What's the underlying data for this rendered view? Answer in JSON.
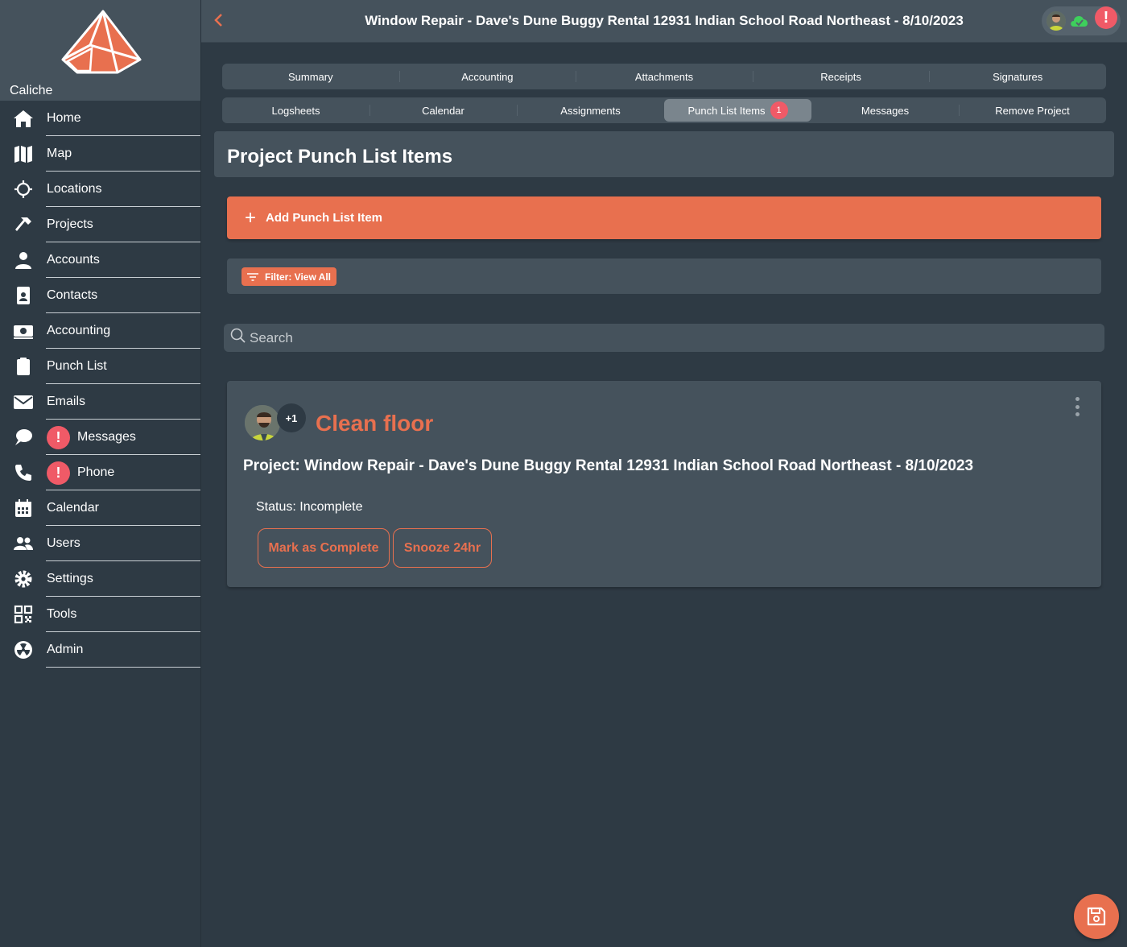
{
  "brand": {
    "name": "Caliche"
  },
  "sidebar": {
    "items": [
      {
        "label": "Home",
        "icon": "home-icon"
      },
      {
        "label": "Map",
        "icon": "map-icon"
      },
      {
        "label": "Locations",
        "icon": "crosshair-icon"
      },
      {
        "label": "Projects",
        "icon": "hammer-icon"
      },
      {
        "label": "Accounts",
        "icon": "person-icon"
      },
      {
        "label": "Contacts",
        "icon": "contact-card-icon"
      },
      {
        "label": "Accounting",
        "icon": "money-icon"
      },
      {
        "label": "Punch List",
        "icon": "clipboard-icon"
      },
      {
        "label": "Emails",
        "icon": "envelope-icon"
      },
      {
        "label": "Messages",
        "icon": "chat-icon",
        "alert": "!"
      },
      {
        "label": "Phone",
        "icon": "phone-icon",
        "alert": "!"
      },
      {
        "label": "Calendar",
        "icon": "calendar-icon"
      },
      {
        "label": "Users",
        "icon": "users-icon"
      },
      {
        "label": "Settings",
        "icon": "gear-icon"
      },
      {
        "label": "Tools",
        "icon": "qr-code-icon"
      },
      {
        "label": "Admin",
        "icon": "radiation-icon"
      }
    ]
  },
  "header": {
    "title": "Window Repair - Dave's Dune Buggy Rental 12931 Indian School Road Northeast - 8/10/2023",
    "back_icon": "chevron-left-icon",
    "alert": "!"
  },
  "tabs": {
    "row1": [
      "Summary",
      "Accounting",
      "Attachments",
      "Receipts",
      "Signatures"
    ],
    "row2": [
      "Logsheets",
      "Calendar",
      "Assignments",
      "Punch List Items",
      "Messages",
      "Remove Project"
    ],
    "active": "Punch List Items",
    "active_badge": "1"
  },
  "section": {
    "title": "Project Punch List Items"
  },
  "add_button": {
    "label": "Add Punch List Item"
  },
  "filter": {
    "label": "Filter: View All"
  },
  "search": {
    "placeholder": "Search"
  },
  "card": {
    "more_assignees": "+1",
    "title": "Clean floor",
    "project": "Project: Window Repair - Dave's Dune Buggy Rental 12931 Indian School Road Northeast - 8/10/2023",
    "status": "Status: Incomplete",
    "complete_label": "Mark as Complete",
    "snooze_label": "Snooze 24hr"
  },
  "colors": {
    "accent": "#e8704f",
    "alert": "#f05a67",
    "panel": "#45525c",
    "background": "#2e3a44"
  }
}
